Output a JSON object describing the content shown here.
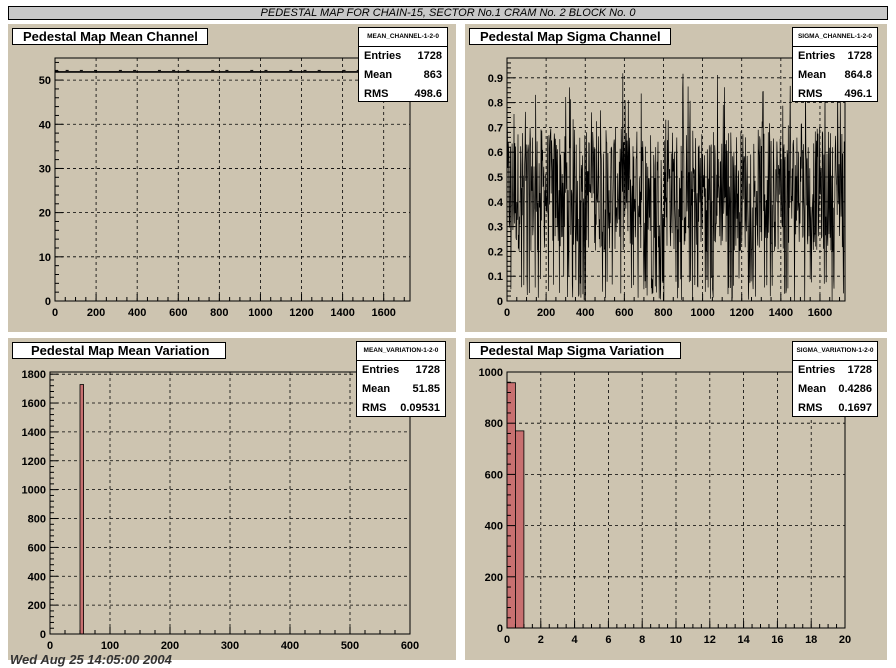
{
  "page": {
    "banner": "PEDESTAL MAP FOR CHAIN-15, SECTOR No.1 CRAM No. 2 BLOCK No. 0",
    "footer": "Wed Aug 25 14:05:00 2004"
  },
  "panels": [
    {
      "title": "Pedestal Map Mean Channel",
      "stats": {
        "name": "MEAN_CHANNEL-1-2-0",
        "entries_label": "Entries",
        "entries": "1728",
        "mean_label": "Mean",
        "mean": "863",
        "rms_label": "RMS",
        "rms": "498.6"
      }
    },
    {
      "title": "Pedestal Map Sigma Channel",
      "stats": {
        "name": "SIGMA_CHANNEL-1-2-0",
        "entries_label": "Entries",
        "entries": "1728",
        "mean_label": "Mean",
        "mean": "864.8",
        "rms_label": "RMS",
        "rms": "496.1"
      }
    },
    {
      "title": "Pedestal Map Mean Variation",
      "stats": {
        "name": "MEAN_VARIATION-1-2-0",
        "entries_label": "Entries",
        "entries": "1728",
        "mean_label": "Mean",
        "mean": "51.85",
        "rms_label": "RMS",
        "rms": "0.09531"
      }
    },
    {
      "title": "Pedestal Map Sigma Variation",
      "stats": {
        "name": "SIGMA_VARIATION-1-2-0",
        "entries_label": "Entries",
        "entries": "1728",
        "mean_label": "Mean",
        "mean": "0.4286",
        "rms_label": "RMS",
        "rms": "0.1697"
      }
    }
  ],
  "chart_data": [
    {
      "type": "line",
      "title": "Pedestal Map Mean Channel",
      "xlim": [
        0,
        1728
      ],
      "ylim": [
        0,
        55
      ],
      "xticks": [
        0,
        200,
        400,
        600,
        800,
        1000,
        1200,
        1400,
        1600
      ],
      "yticks": [
        0,
        10,
        20,
        30,
        40,
        50
      ],
      "grid": true,
      "legend": "top-right",
      "series": [
        {
          "constant": 51.85,
          "n": 1728
        }
      ]
    },
    {
      "type": "line",
      "title": "Pedestal Map Sigma Channel",
      "xlim": [
        0,
        1728
      ],
      "ylim": [
        0,
        0.98
      ],
      "xticks": [
        0,
        200,
        400,
        600,
        800,
        1000,
        1200,
        1400,
        1600
      ],
      "yticks": [
        0,
        0.1,
        0.2,
        0.3,
        0.4,
        0.5,
        0.6,
        0.7,
        0.8,
        0.9
      ],
      "grid": true,
      "legend": "top-right",
      "series": [
        {
          "noise": {
            "n": 1728,
            "mean": 0.4286,
            "min": 0,
            "max": 0.93
          }
        }
      ]
    },
    {
      "type": "bar",
      "title": "Pedestal Map Mean Variation",
      "xlim": [
        0,
        600
      ],
      "ylim": [
        0,
        1815
      ],
      "xticks": [
        0,
        100,
        200,
        300,
        400,
        500,
        600
      ],
      "yticks": [
        0,
        200,
        400,
        600,
        800,
        1000,
        1200,
        1400,
        1600,
        1800
      ],
      "grid": true,
      "legend": "top-right",
      "bar_color": "#c87070",
      "bins": [
        {
          "x0": 50,
          "x1": 56,
          "value": 1728
        }
      ]
    },
    {
      "type": "bar",
      "title": "Pedestal Map Sigma Variation",
      "xlim": [
        0,
        20
      ],
      "ylim": [
        0,
        1000
      ],
      "xticks": [
        0,
        2,
        4,
        6,
        8,
        10,
        12,
        14,
        16,
        18,
        20
      ],
      "yticks": [
        0,
        200,
        400,
        600,
        800,
        1000
      ],
      "grid": true,
      "legend": "top-right",
      "bar_color": "#c87070",
      "bins": [
        {
          "x0": 0,
          "x1": 0.5,
          "value": 958
        },
        {
          "x0": 0.5,
          "x1": 1.0,
          "value": 770
        }
      ]
    }
  ]
}
